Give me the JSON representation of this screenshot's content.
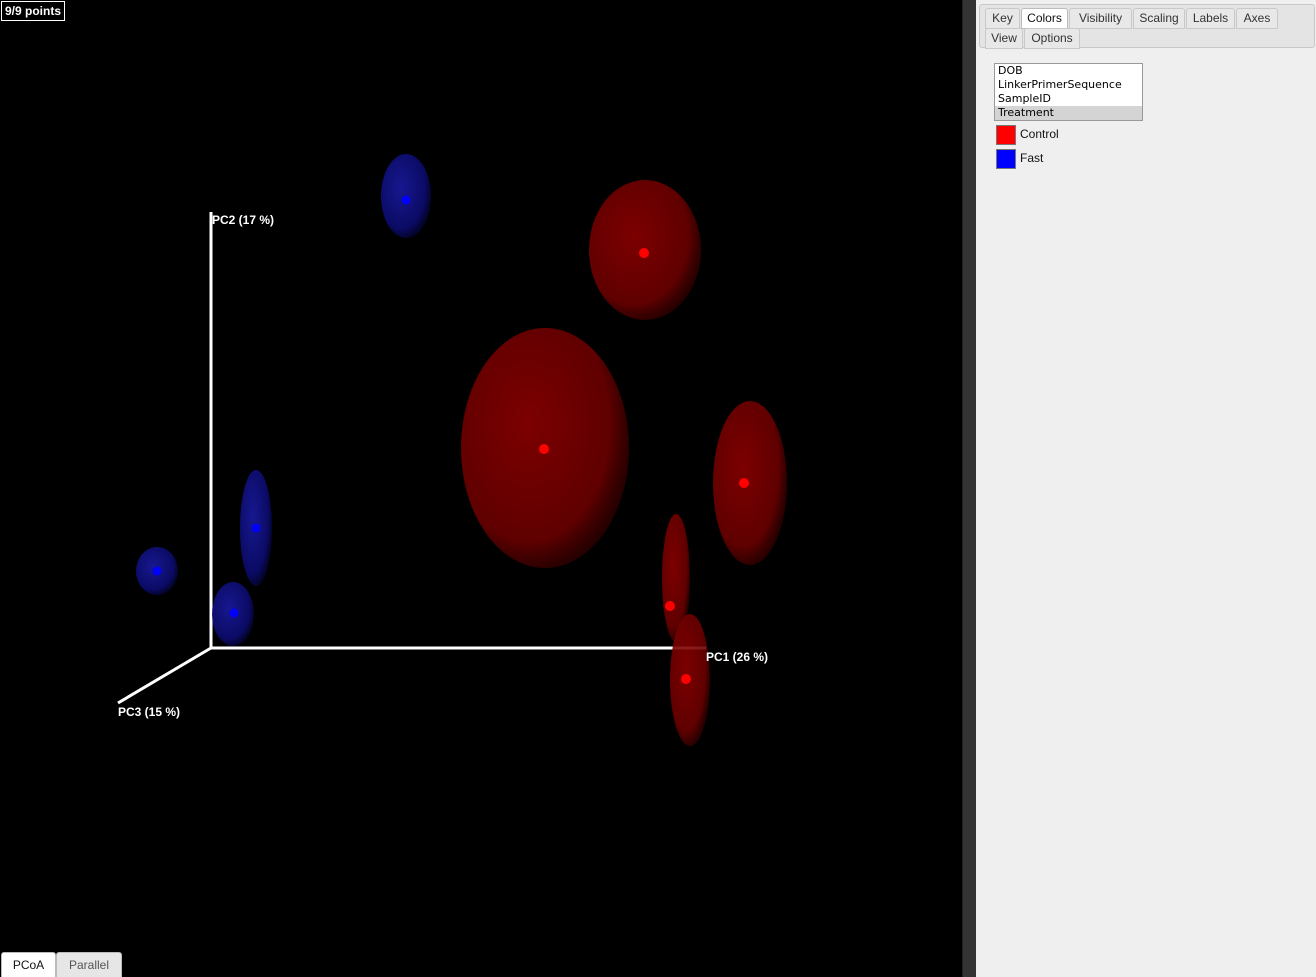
{
  "plot": {
    "points_count": "9/9 points",
    "background_color": "#000000",
    "axis_color": "#ffffff",
    "axes": {
      "pc1": "PC1 (26 %)",
      "pc2": "PC2 (17 %)",
      "pc3": "PC3 (15 %)"
    },
    "samples": [
      {
        "group": "Fast",
        "color": "#0000ff"
      },
      {
        "group": "Fast",
        "color": "#0000ff"
      },
      {
        "group": "Fast",
        "color": "#0000ff"
      },
      {
        "group": "Fast",
        "color": "#0000ff"
      },
      {
        "group": "Control",
        "color": "#ff0000"
      },
      {
        "group": "Control",
        "color": "#ff0000"
      },
      {
        "group": "Control",
        "color": "#ff0000"
      },
      {
        "group": "Control",
        "color": "#ff0000"
      },
      {
        "group": "Control",
        "color": "#ff0000"
      }
    ]
  },
  "side_panel": {
    "tabs": [
      {
        "label": "Key",
        "active": false
      },
      {
        "label": "Colors",
        "active": true
      },
      {
        "label": "Visibility",
        "active": false
      },
      {
        "label": "Scaling",
        "active": false
      },
      {
        "label": "Labels",
        "active": false
      },
      {
        "label": "Axes",
        "active": false
      },
      {
        "label": "View",
        "active": false
      },
      {
        "label": "Options",
        "active": false
      }
    ],
    "category_list": [
      "DOB",
      "LinkerPrimerSequence",
      "SampleID",
      "Treatment"
    ],
    "selected_category": "Treatment",
    "legend": [
      {
        "label": "Control",
        "color": "#ff0000"
      },
      {
        "label": "Fast",
        "color": "#0000ff"
      }
    ]
  },
  "bottom_tabs": [
    {
      "label": "PCoA",
      "active": true
    },
    {
      "label": "Parallel",
      "active": false
    }
  ]
}
